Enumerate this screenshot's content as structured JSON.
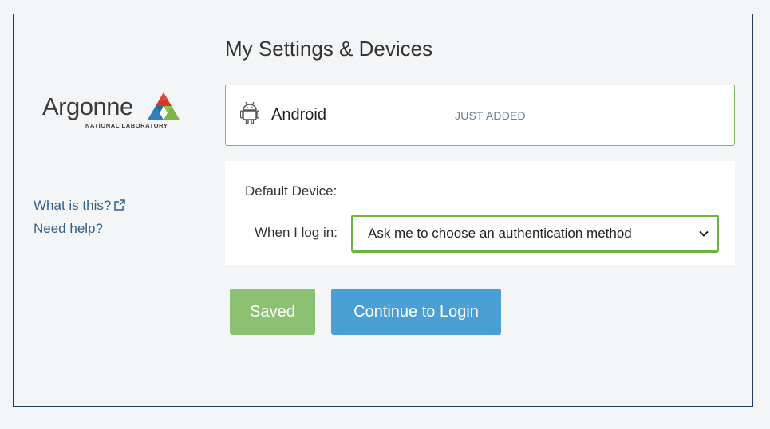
{
  "page": {
    "title": "My Settings & Devices"
  },
  "logo": {
    "name": "Argonne",
    "subtitle": "NATIONAL LABORATORY"
  },
  "help": {
    "what_is_this": "What is this?",
    "need_help": "Need help?"
  },
  "device": {
    "name": "Android",
    "status": "JUST ADDED",
    "icon": "android-icon"
  },
  "default_device": {
    "label": "Default Device:",
    "login_label": "When I log in:",
    "selected": "Ask me to choose an authentication method"
  },
  "buttons": {
    "saved": "Saved",
    "continue": "Continue to Login"
  },
  "colors": {
    "accent_green": "#6db33f",
    "saved_button": "#8cc173",
    "continue_button": "#4a9fd5",
    "link": "#2f5f8a"
  }
}
